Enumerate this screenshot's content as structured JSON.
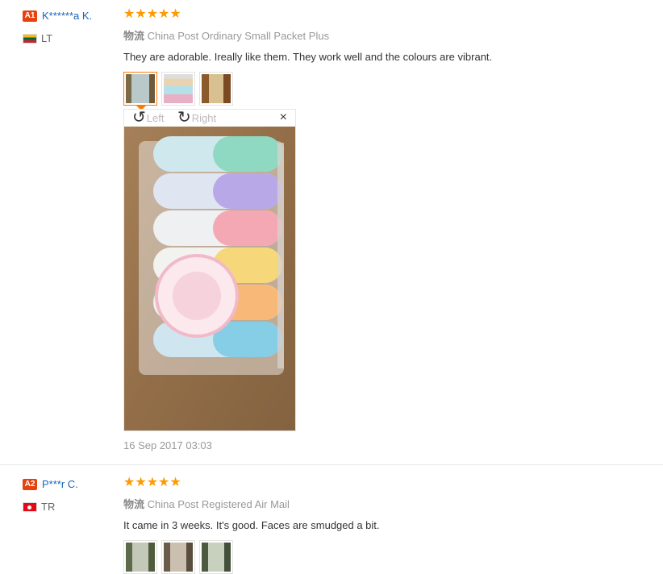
{
  "reviews": [
    {
      "level": "A1",
      "user": "K******a K.",
      "country_code": "LT",
      "stars": "★★★★★",
      "logistics_prefix": "物流",
      "logistics": "China Post Ordinary Small Packet Plus",
      "feedback": "They are adorable. Ireally like them. They work well and the colours are vibrant.",
      "viewer": {
        "rotate_left": "Left",
        "rotate_right": "Right",
        "close": "×"
      },
      "date": "16 Sep 2017 03:03"
    },
    {
      "level": "A2",
      "user": "P***r C.",
      "country_code": "TR",
      "stars": "★★★★★",
      "logistics_prefix": "物流",
      "logistics": "China Post Registered Air Mail",
      "feedback": "It came in 3 weeks. It's good. Faces are smudged a bit."
    }
  ],
  "colors": {
    "star": "#ff9a00",
    "username": "#1565c0",
    "badge": "#e5420f",
    "active_thumb": "#ff7a00"
  }
}
